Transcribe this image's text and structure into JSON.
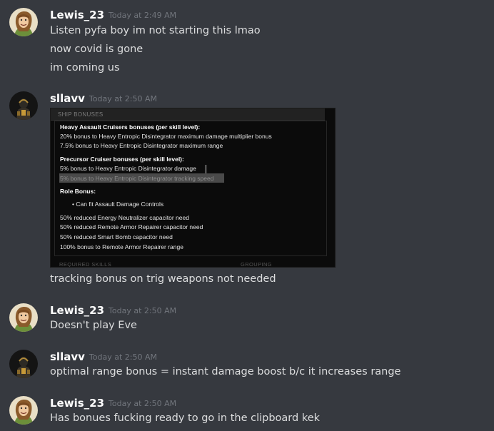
{
  "messages": [
    {
      "username": "Lewis_23",
      "timestamp": "Today at 2:49 AM",
      "avatar": "lewis-avatar",
      "lines": [
        "Listen pyfa boy im not starting this lmao",
        "now covid is gone",
        "im coming us"
      ]
    },
    {
      "username": "sllavv",
      "timestamp": "Today at 2:50 AM",
      "avatar": "sllavv-avatar",
      "embed": {
        "header": "SHIP BONUSES",
        "lines": [
          {
            "text": "Heavy Assault Cruisers bonuses (per skill level):",
            "style": "h"
          },
          {
            "text": "20% bonus to Heavy Entropic Disintegrator maximum damage multiplier bonus",
            "style": ""
          },
          {
            "text": "7.5% bonus to Heavy Entropic Disintegrator maximum range",
            "style": ""
          },
          {
            "text": "Precursor Cruiser bonuses (per skill level):",
            "style": "h"
          },
          {
            "text": "5% bonus to Heavy Entropic Disintegrator damage",
            "style": ""
          },
          {
            "text": "5% bonus to Heavy Entropic Disintegrator tracking speed",
            "style": "dim"
          },
          {
            "text": "Role Bonus:",
            "style": "h"
          },
          {
            "text": "• Can fit Assault Damage Controls",
            "style": ""
          },
          {
            "text": "50% reduced Energy Neutralizer capacitor need",
            "style": ""
          },
          {
            "text": "50% reduced Remote Armor Repairer capacitor need",
            "style": ""
          },
          {
            "text": "50% reduced Smart Bomb capacitor need",
            "style": ""
          },
          {
            "text": "100% bonus to Remote Armor Repairer range",
            "style": ""
          }
        ],
        "footer_left": "REQUIRED SKILLS",
        "footer_right": "GROUPING"
      },
      "lines": [
        "tracking bonus on trig weapons not needed"
      ]
    },
    {
      "username": "Lewis_23",
      "timestamp": "Today at 2:50 AM",
      "avatar": "lewis-avatar",
      "lines": [
        "Doesn't play Eve"
      ]
    },
    {
      "username": "sllavv",
      "timestamp": "Today at 2:50 AM",
      "avatar": "sllavv-avatar",
      "lines": [
        "optimal range bonus = instant damage boost b/c it increases range"
      ]
    },
    {
      "username": "Lewis_23",
      "timestamp": "Today at 2:50 AM",
      "avatar": "lewis-avatar",
      "lines": [
        "Has bonues fucking ready to go in the clipboard kek"
      ]
    }
  ]
}
